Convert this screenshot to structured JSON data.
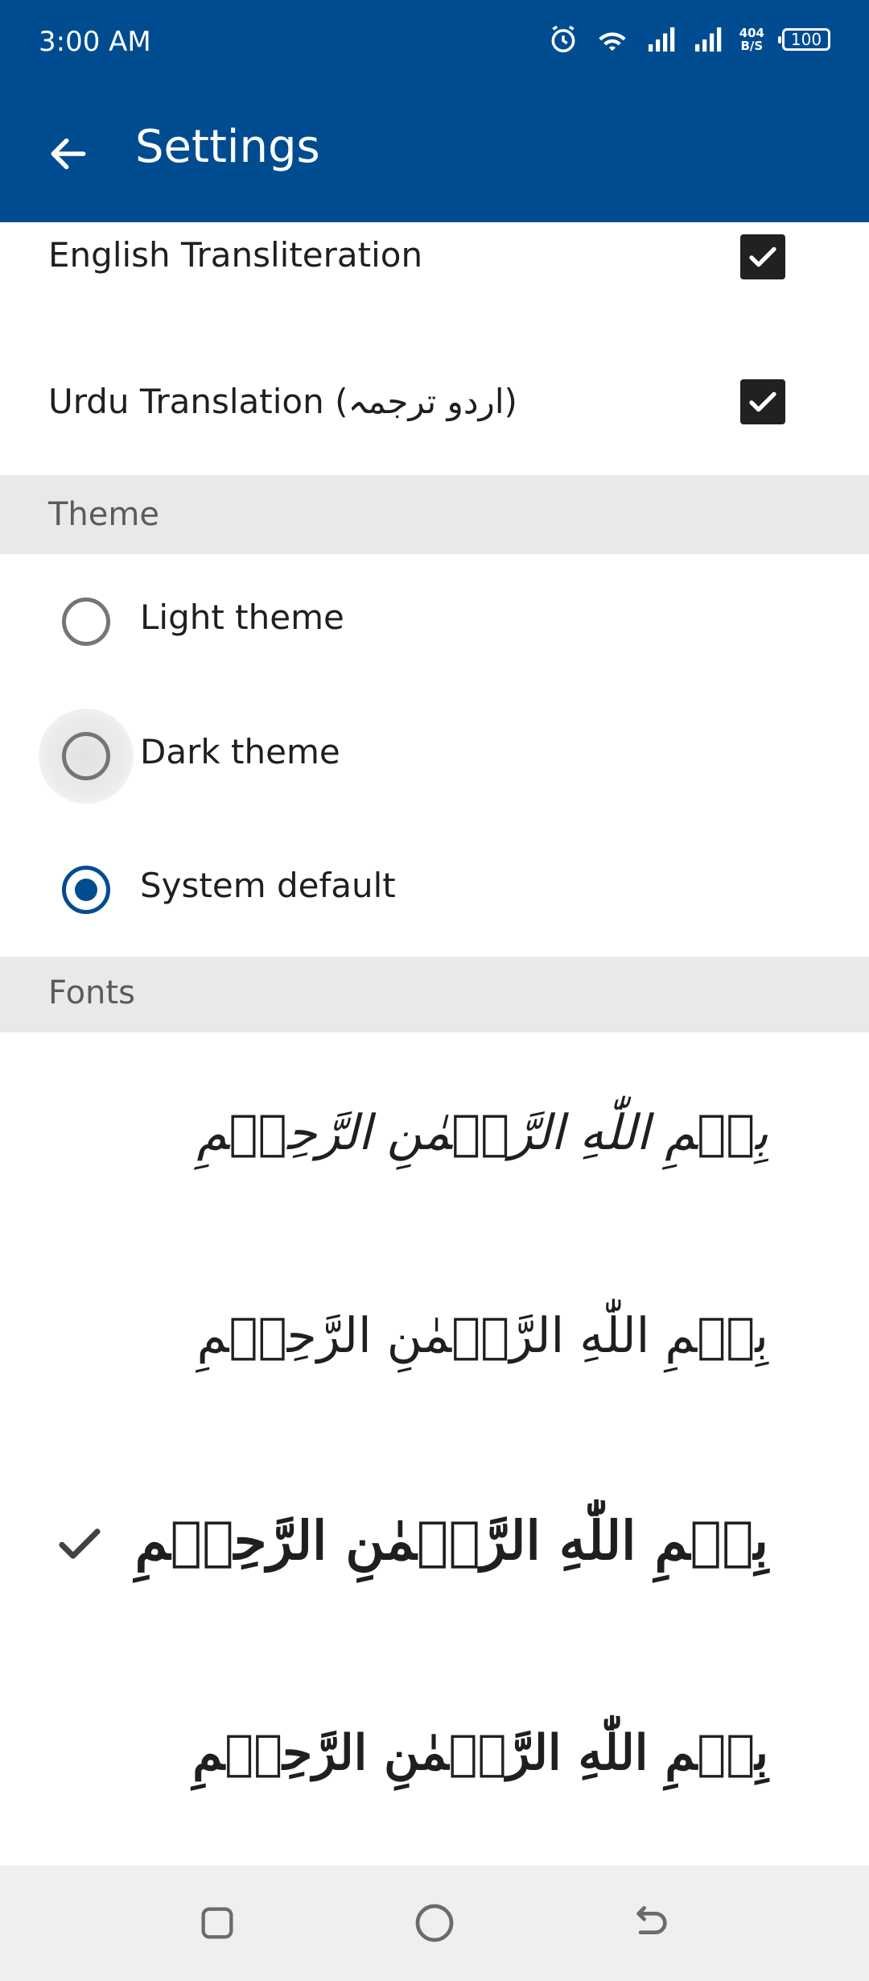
{
  "status_bar": {
    "time": "3:00 AM",
    "net_speed_value": "404",
    "net_speed_unit": "B/S",
    "battery": "100"
  },
  "app_bar": {
    "title": "Settings"
  },
  "translations": [
    {
      "label": "English Transliteration",
      "checked": true
    },
    {
      "label": "Urdu Translation (اردو ترجمہ)",
      "checked": true
    }
  ],
  "theme": {
    "header": "Theme",
    "options": [
      {
        "label": "Light theme",
        "selected": false
      },
      {
        "label": "Dark theme",
        "selected": false
      },
      {
        "label": "System default",
        "selected": true
      }
    ]
  },
  "fonts": {
    "header": "Fonts",
    "options": [
      {
        "sample": "بِسۡمِ اللّٰهِ الرَّحۡمٰنِ الرَّحِيۡمِ",
        "selected": false
      },
      {
        "sample": "بِسۡمِ اللّٰهِ الرَّحۡمٰنِ الرَّحِيۡمِ",
        "selected": false
      },
      {
        "sample": "بِسۡمِ اللّٰهِ الرَّحۡمٰنِ الرَّحِيۡمِ",
        "selected": true
      },
      {
        "sample": "بِسۡمِ اللّٰهِ الرَّحۡمٰنِ الرَّحِيۡمِ",
        "selected": false
      }
    ]
  },
  "colors": {
    "primary": "#004c91",
    "section_bg": "#e9e9e9",
    "navbar_bg": "#efefef"
  }
}
